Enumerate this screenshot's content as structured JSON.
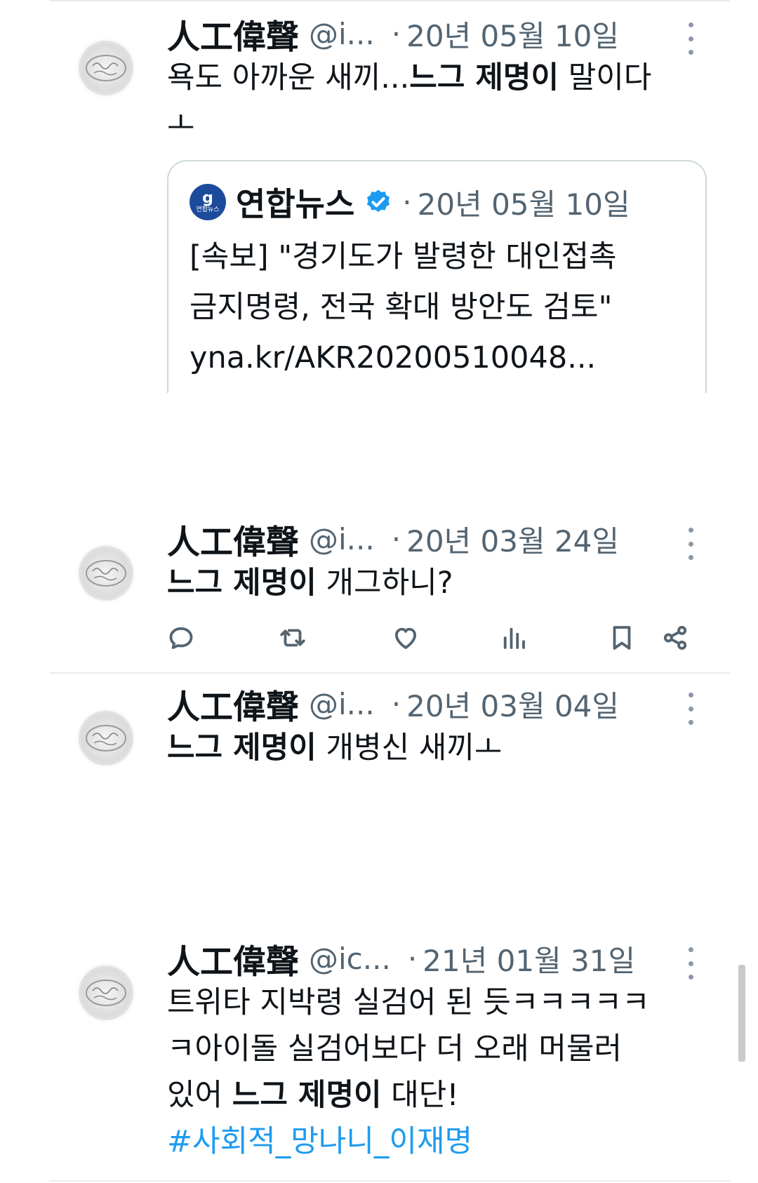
{
  "tweets": [
    {
      "name": "人工偉聲",
      "handle": "@i...",
      "date": "20년 05월 10일",
      "body_pre": "욕도 아까운 새끼...",
      "body_bold": "느그 제명이",
      "body_post": " 말이다",
      "body_line2": "ㅗ",
      "quote": {
        "logo_text": "연합뉴스",
        "name": "연합뉴스",
        "date": "20년 05월 10일",
        "line1": "[속보] \"경기도가 발령한 대인접촉",
        "line2": "금지명령, 전국 확대 방안도 검토\"",
        "line3": "yna.kr/AKR20200510048..."
      }
    },
    {
      "name": "人工偉聲",
      "handle": "@i...",
      "date": "20년 03월 24일",
      "body_bold": "느그 제명이",
      "body_post": " 개그하니?"
    },
    {
      "name": "人工偉聲",
      "handle": "@i...",
      "date": "20년 03월 04일",
      "body_bold": "느그 제명이",
      "body_post": " 개병신 새끼ㅗ"
    },
    {
      "name": "人工偉聲",
      "handle": "@ic...",
      "date": "21년 01월 31일",
      "line1": "트위타 지박령 실검어 된 듯ㅋㅋㅋㅋㅋ",
      "line2": "ㅋ아이돌 실검어보다 더 오래 머물러",
      "line3_pre": "있어 ",
      "line3_bold": "느그 제명이",
      "line3_post": " 대단!",
      "hashtag": "#사회적_망나니_이재명"
    }
  ],
  "icons": {
    "actions": [
      "reply-icon",
      "retweet-icon",
      "like-icon",
      "views-icon",
      "bookmark-icon",
      "share-icon"
    ],
    "more": "more-icon",
    "verified": "verified-badge-icon",
    "avatar": "avatar-image"
  },
  "colors": {
    "text": "#0f1419",
    "secondary": "#536471",
    "link": "#1d9bf0",
    "border": "#cfd9de"
  }
}
